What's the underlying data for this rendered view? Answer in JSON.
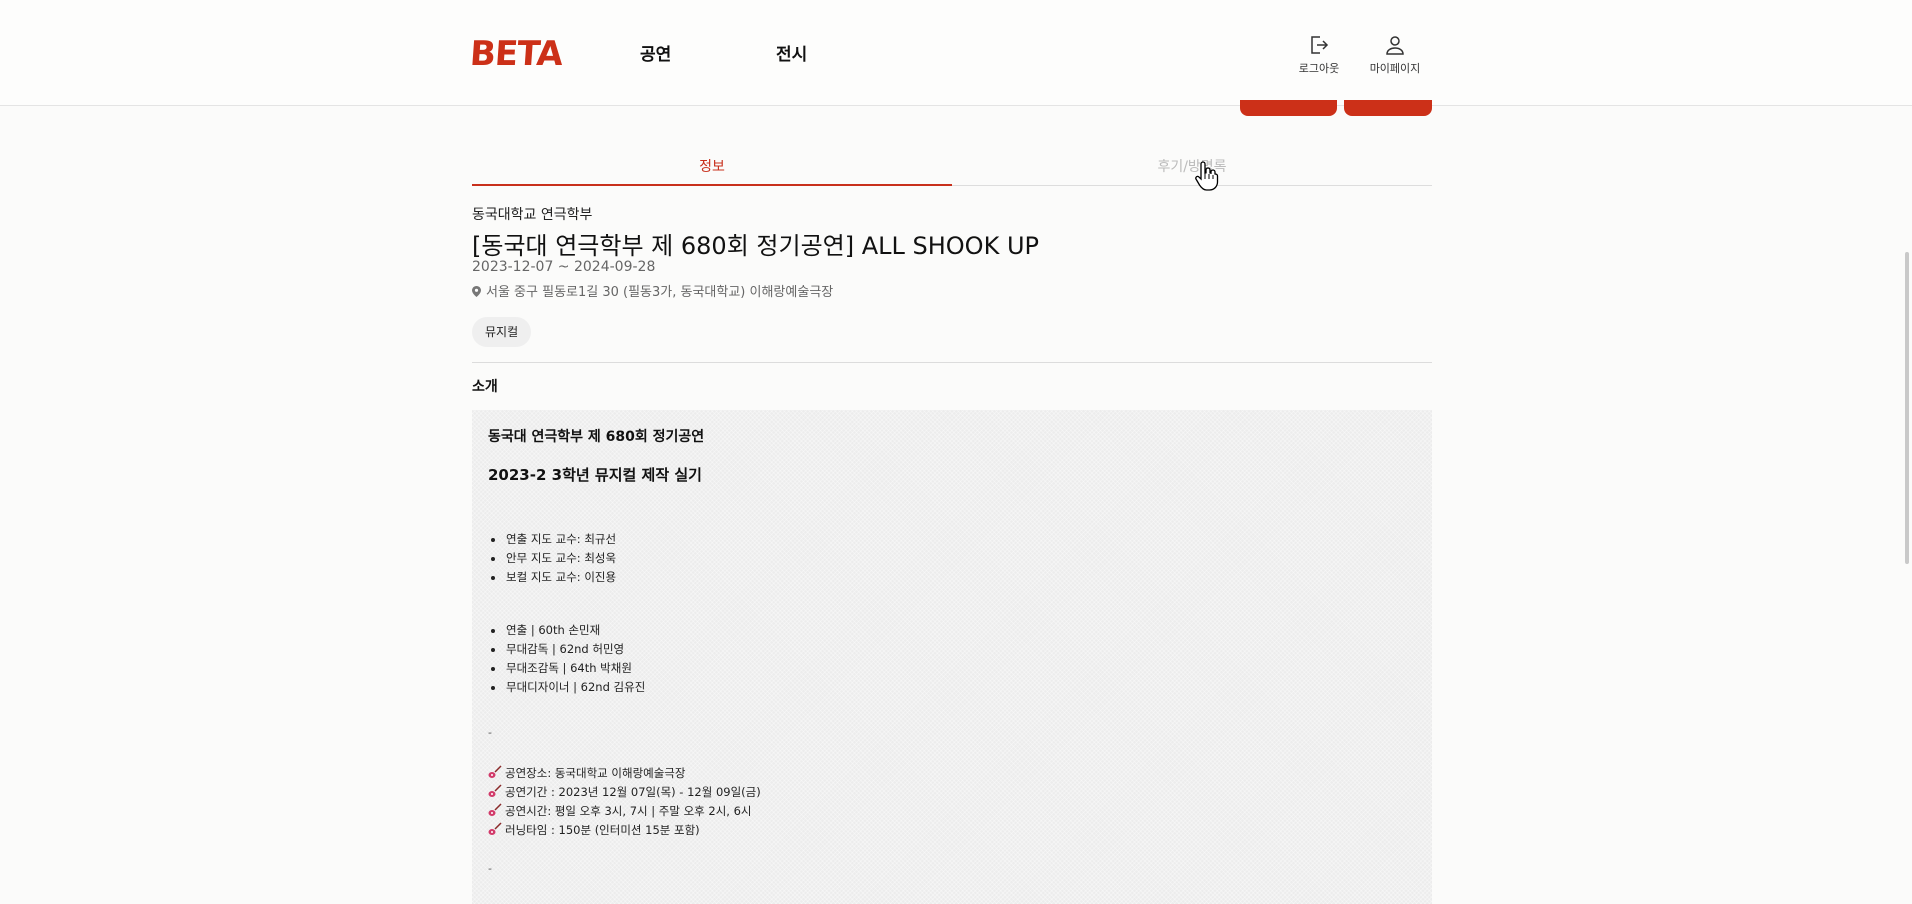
{
  "header": {
    "logo": "BETA",
    "nav": [
      "공연",
      "전시"
    ],
    "logout_label": "로그아웃",
    "mypage_label": "마이페이지"
  },
  "tabs": {
    "info": "정보",
    "review": "후기/방명록"
  },
  "event": {
    "organizer": "동국대학교 연극학부",
    "title": "[동국대 연극학부 제 680회 정기공연] ALL SHOOK UP",
    "dates": "2023-12-07 ~ 2024-09-28",
    "address": "서울 중구 필동로1길 30 (필동3가, 동국대학교) 이해랑예술극장",
    "tag": "뮤지컬"
  },
  "intro": {
    "heading": "소개",
    "line1": "동국대 연극학부 제 680회 정기공연",
    "line2": "2023-2 3학년 뮤지컬 제작 실기",
    "professors": [
      "연출 지도 교수: 최규선",
      "안무 지도 교수: 최성욱",
      "보컬 지도 교수: 이진용"
    ],
    "staff": [
      "연출 | 60th 손민재",
      "무대감독 | 62nd 허민영",
      "무대조감독 | 64th 박채원",
      "무대디자이너 | 62nd 김유진"
    ],
    "dash": "-",
    "details": [
      "공연장소: 동국대학교 이해랑예술극장",
      "공연기간 : 2023년 12월 07일(목) - 12월 09일(금)",
      "공연시간: 평일 오후 3시, 7시 | 주말 오후 2시, 6시",
      "러닝타임 : 150분 (인터미션 15분 포함)"
    ],
    "icon": "guitar-icon"
  },
  "colors": {
    "accent": "#cc3018",
    "tab_inactive": "#bbbbbb",
    "desc_bg": "#ececec"
  }
}
